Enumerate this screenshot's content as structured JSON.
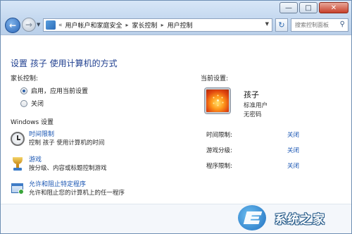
{
  "titlebar": {
    "minimize_glyph": "—",
    "maximize_glyph": "□",
    "close_glyph": "✕"
  },
  "nav": {
    "back_glyph": "←",
    "forward_glyph": "→",
    "dropdown_glyph": "▼"
  },
  "address": {
    "chevron": "«",
    "breadcrumbs": [
      "用户帐户和家庭安全",
      "家长控制",
      "用户控制"
    ],
    "separator": "▸",
    "dropdown_glyph": "▼",
    "refresh_glyph": "↻"
  },
  "search": {
    "placeholder": "搜索控制面板",
    "icon": "search-icon",
    "icon_glyph": "⚲"
  },
  "page": {
    "title": "设置 孩子 使用计算机的方式",
    "parental_control_label": "家长控制:",
    "options": {
      "on": "启用，应用当前设置",
      "off": "关闭"
    },
    "selected_option": "on",
    "windows_settings_label": "Windows 设置",
    "settings": [
      {
        "icon": "clock-icon",
        "link": "时间限制",
        "desc": "控制 孩子 使用计算机的时间"
      },
      {
        "icon": "trophy-icon",
        "link": "游戏",
        "desc": "按分级、内容或标题控制游戏"
      },
      {
        "icon": "allow-programs-icon",
        "link": "允许和阻止特定程序",
        "desc": "允许和阻止您的计算机上的任一程序"
      }
    ]
  },
  "current_settings": {
    "label": "当前设置:",
    "user": {
      "name": "孩子",
      "type": "标准用户",
      "password": "无密码"
    },
    "rows": [
      {
        "label": "时间限制:",
        "value": "关闭"
      },
      {
        "label": "游戏分级:",
        "value": "关闭"
      },
      {
        "label": "程序限制:",
        "value": "关闭"
      }
    ]
  },
  "watermark": {
    "text": "系统之家"
  },
  "colors": {
    "link": "#1a56b3",
    "title": "#1e3e8f",
    "avatar_accent": "#ff9a1c"
  }
}
